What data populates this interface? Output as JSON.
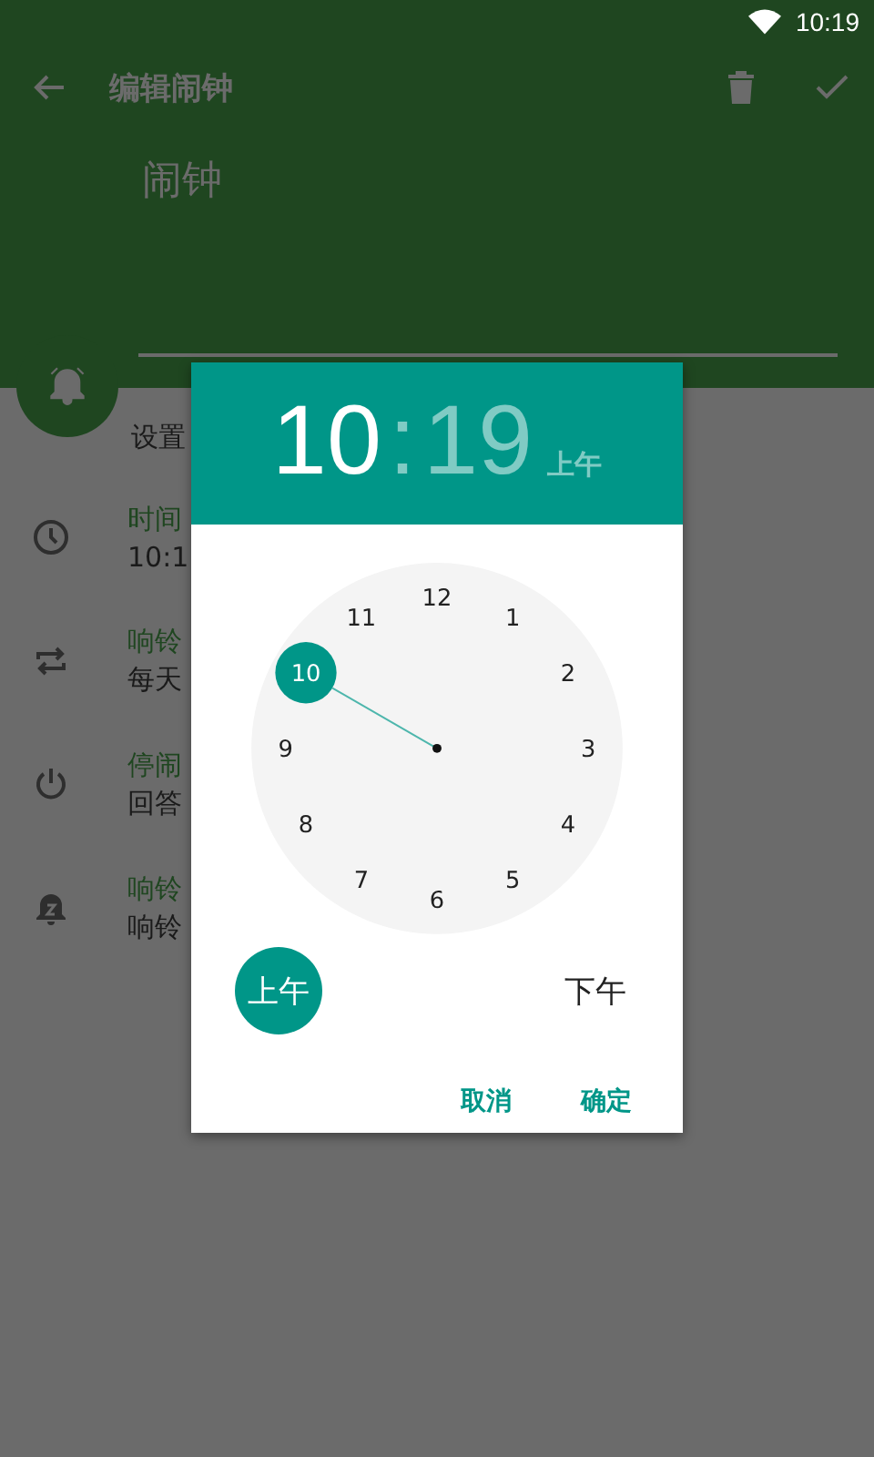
{
  "status_bar": {
    "time": "10:19"
  },
  "toolbar": {
    "title": "编辑闹钟"
  },
  "label_field": {
    "value": "闹钟"
  },
  "section_title": "设置",
  "settings": [
    {
      "kind": "time",
      "title": "时间",
      "value": "10:1"
    },
    {
      "kind": "repeat",
      "title": "响铃",
      "value": "每天"
    },
    {
      "kind": "dismiss",
      "title": "停闹",
      "value": "回答"
    },
    {
      "kind": "snooze",
      "title": "响铃",
      "value": "响铃"
    }
  ],
  "time_picker": {
    "hour": "10",
    "separator": ":",
    "minute": "19",
    "period": "上午",
    "hour_selected": true,
    "hours": [
      {
        "label": "12",
        "selected": false
      },
      {
        "label": "1",
        "selected": false
      },
      {
        "label": "2",
        "selected": false
      },
      {
        "label": "3",
        "selected": false
      },
      {
        "label": "4",
        "selected": false
      },
      {
        "label": "5",
        "selected": false
      },
      {
        "label": "6",
        "selected": false
      },
      {
        "label": "7",
        "selected": false
      },
      {
        "label": "8",
        "selected": false
      },
      {
        "label": "9",
        "selected": false
      },
      {
        "label": "10",
        "selected": true
      },
      {
        "label": "11",
        "selected": false
      }
    ],
    "am": {
      "label": "上午",
      "selected": true
    },
    "pm": {
      "label": "下午",
      "selected": false
    },
    "buttons": [
      "取消",
      "确定"
    ]
  }
}
